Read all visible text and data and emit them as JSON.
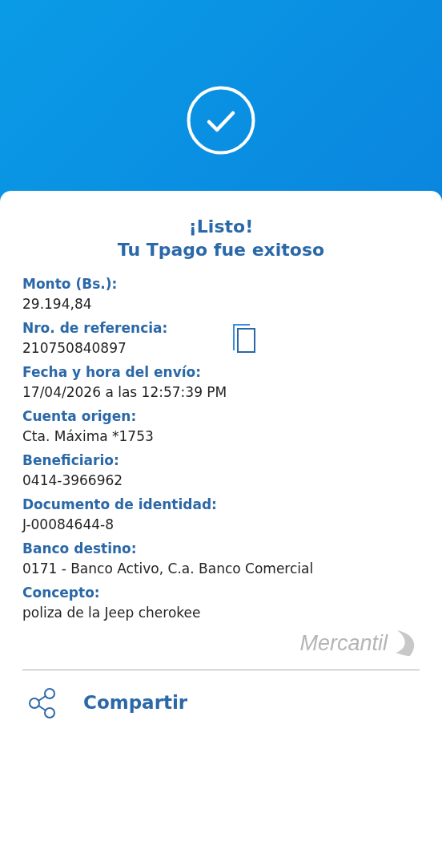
{
  "title_lines": [
    "¡Listo!",
    "Tu Tpago fue exitoso"
  ],
  "fields": [
    {
      "label": "Monto (Bs.):",
      "value": "29.194,84",
      "kind": "plain"
    },
    {
      "label": "Nro. de referencia:",
      "value": "210750840897",
      "kind": "copyable"
    },
    {
      "label": "Fecha y hora del envío:",
      "value": "17/04/2026 a las 12:57:39 PM",
      "kind": "plain"
    },
    {
      "label": "Cuenta origen:",
      "value": "Cta. Máxima *1753",
      "kind": "plain"
    },
    {
      "label": "Beneficiario:",
      "value": "0414-3966962",
      "kind": "plain"
    },
    {
      "label": "Documento de identidad:",
      "value": "J-00084644-8",
      "kind": "plain"
    },
    {
      "label": "Banco destino:",
      "value": "0171 - Banco Activo, C.a. Banco Comercial",
      "kind": "plain"
    },
    {
      "label": "Concepto:",
      "value": "poliza de la Jeep cherokee",
      "kind": "plain"
    }
  ],
  "logo": "Mercantil",
  "share_button": "Compartir"
}
